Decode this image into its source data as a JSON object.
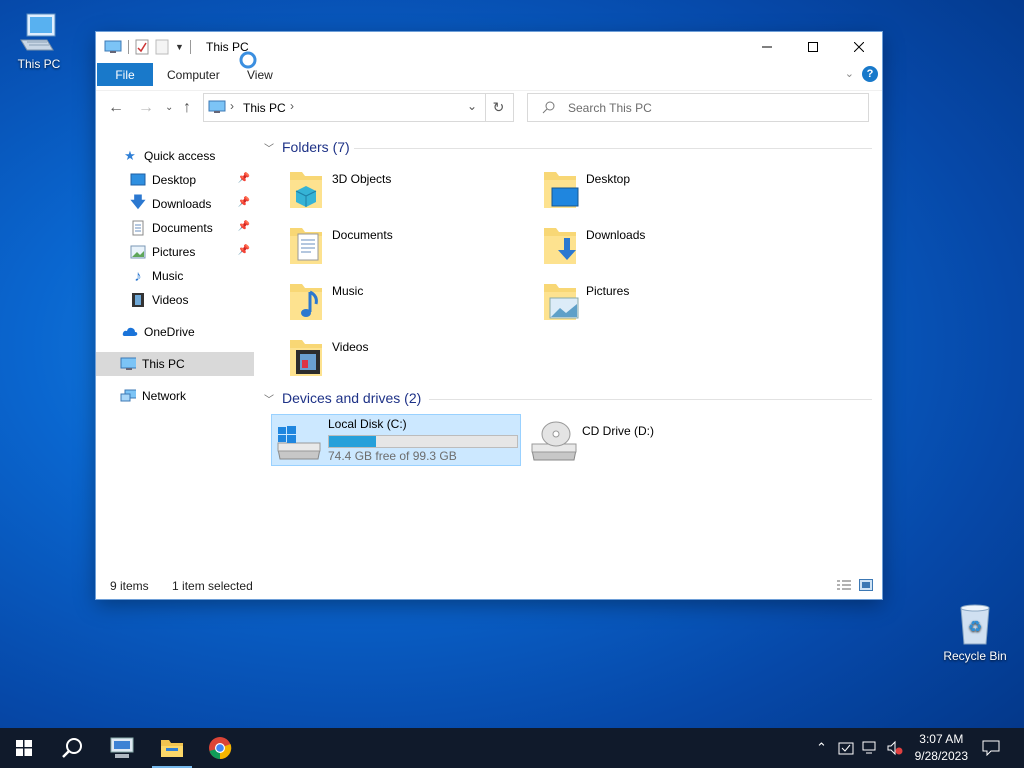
{
  "desktop": {
    "this_pc_label": "This PC",
    "recycle_bin_label": "Recycle Bin"
  },
  "window": {
    "title": "This PC",
    "tabs": {
      "file": "File",
      "computer": "Computer",
      "view": "View"
    },
    "help": "?",
    "address": "This PC",
    "search_placeholder": "Search This PC"
  },
  "navpane": {
    "quick_access": "Quick access",
    "items": [
      {
        "label": "Desktop",
        "pinned": true
      },
      {
        "label": "Downloads",
        "pinned": true
      },
      {
        "label": "Documents",
        "pinned": true
      },
      {
        "label": "Pictures",
        "pinned": true
      },
      {
        "label": "Music",
        "pinned": false
      },
      {
        "label": "Videos",
        "pinned": false
      }
    ],
    "onedrive": "OneDrive",
    "this_pc": "This PC",
    "network": "Network"
  },
  "content": {
    "folders_header": "Folders (7)",
    "folders": [
      "3D Objects",
      "Desktop",
      "Documents",
      "Downloads",
      "Music",
      "Pictures",
      "Videos"
    ],
    "drives_header": "Devices and drives (2)",
    "drives": [
      {
        "name": "Local Disk (C:)",
        "free_text": "74.4 GB free of 99.3 GB",
        "used_fraction": 0.25,
        "selected": true
      },
      {
        "name": "CD Drive (D:)"
      }
    ]
  },
  "status": {
    "items": "9 items",
    "selected": "1 item selected"
  },
  "taskbar": {
    "time": "3:07 AM",
    "date": "9/28/2023"
  },
  "colors": {
    "accent": "#1979ca",
    "selection": "#cce8ff",
    "section_header": "#1e3287",
    "taskbar": "#101a2b"
  }
}
